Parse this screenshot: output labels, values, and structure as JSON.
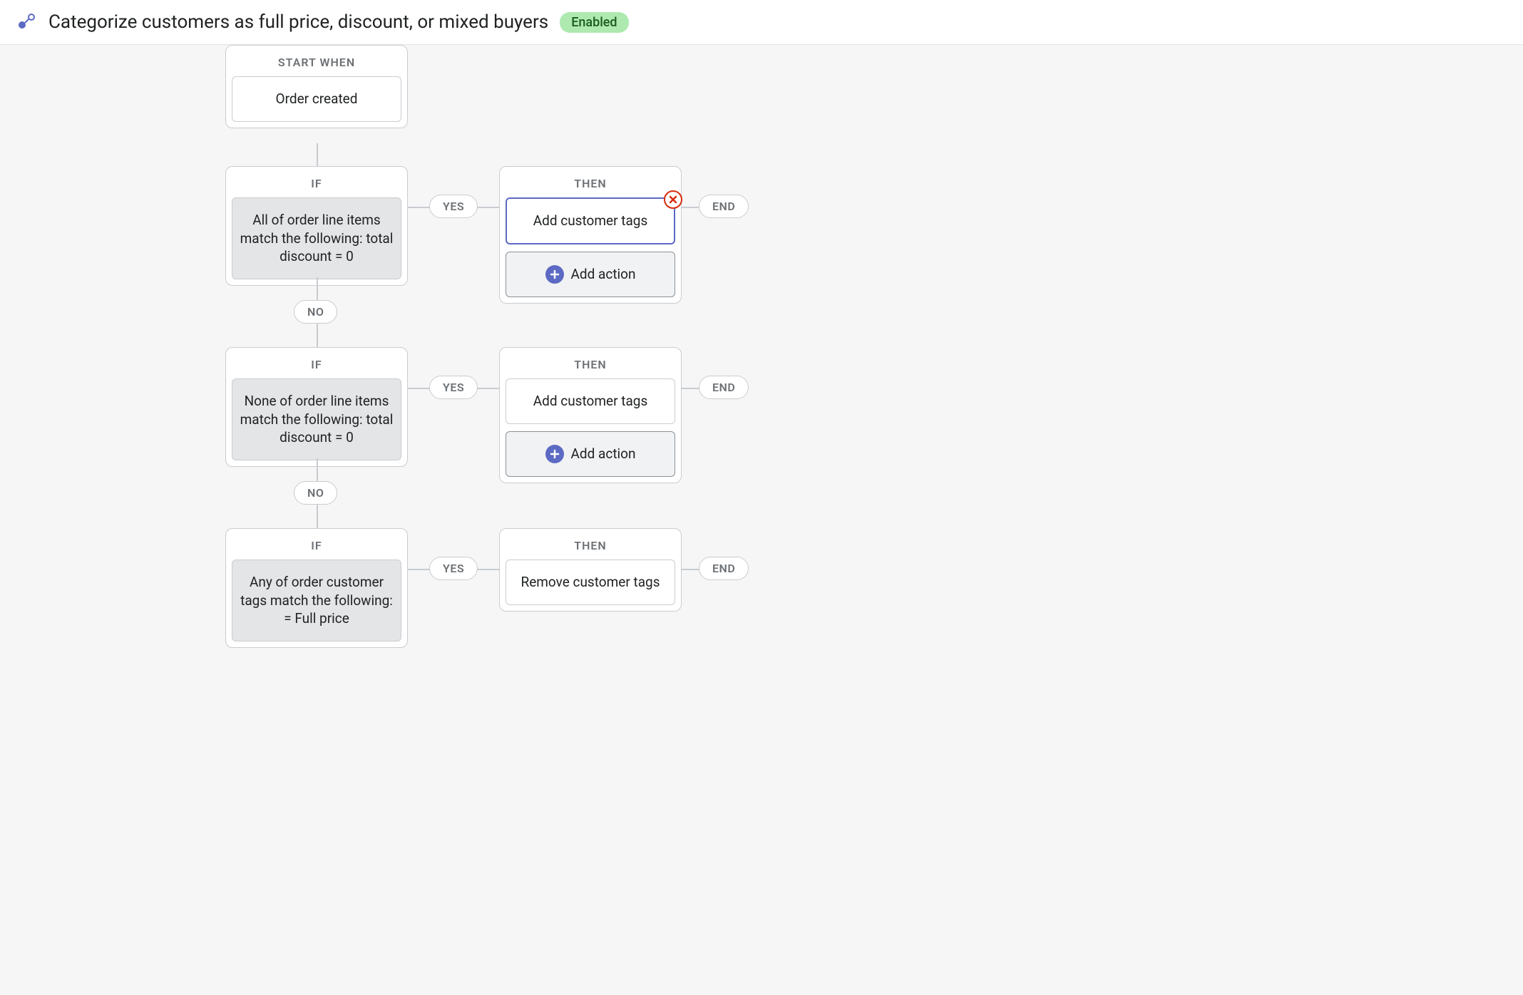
{
  "header": {
    "title": "Categorize customers as full price, discount, or mixed buyers",
    "status": "Enabled"
  },
  "labels": {
    "start_when": "START WHEN",
    "if": "IF",
    "then": "THEN",
    "yes": "YES",
    "no": "NO",
    "end": "END",
    "add_action": "Add action"
  },
  "trigger": {
    "text": "Order created"
  },
  "conditions": [
    {
      "text": "All of order line items match the following:  total discount = 0",
      "then_action": "Add customer tags",
      "selected": true,
      "show_add_action": true
    },
    {
      "text": "None of order line items match the following:  total discount = 0",
      "then_action": "Add customer tags",
      "selected": false,
      "show_add_action": true
    },
    {
      "text": "Any of order customer tags match the following:  = Full price",
      "then_action": "Remove customer tags",
      "selected": false,
      "show_add_action": false
    }
  ]
}
